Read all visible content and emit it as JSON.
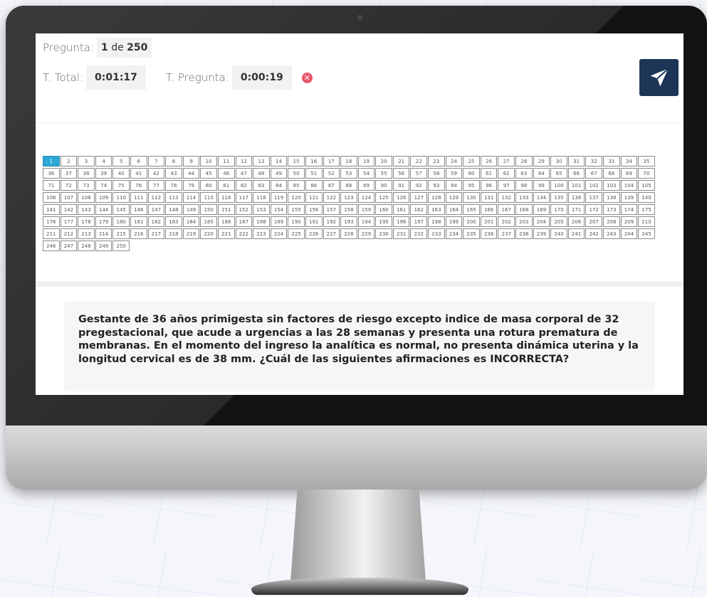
{
  "header": {
    "pregunta_label": "Pregunta:",
    "pregunta_current": "1",
    "pregunta_de": "de",
    "pregunta_total": "250",
    "t_total_label": "T. Total:",
    "t_total_value": "0:01:17",
    "t_pregunta_label": "T. Pregunta:",
    "t_pregunta_value": "0:00:19"
  },
  "icons": {
    "cancel": "x-circle-icon",
    "send": "paper-plane-icon"
  },
  "colors": {
    "send_button": "#1d3557",
    "active_question": "#2ea8d6",
    "cancel_icon": "#e8566a"
  },
  "question_grid": {
    "count": 250,
    "active": 1
  },
  "question": {
    "text": "Gestante de 36 años primigesta sin factores de riesgo excepto indice de masa corporal de 32 pregestacional, que acude a urgencias a las 28 semanas y presenta una rotura prematura de membranas. En el momento del ingreso la analítica es normal, no presenta dinámica uterina y la longitud cervical es de 38 mm. ¿Cuál de las siguientes afirmaciones es INCORRECTA?"
  }
}
